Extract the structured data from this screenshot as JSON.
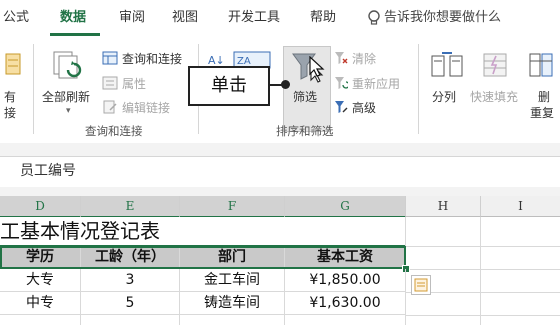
{
  "tabs": [
    {
      "label": "公式",
      "active": false
    },
    {
      "label": "数据",
      "active": true
    },
    {
      "label": "审阅",
      "active": false
    },
    {
      "label": "视图",
      "active": false
    },
    {
      "label": "开发工具",
      "active": false
    },
    {
      "label": "帮助",
      "active": false
    }
  ],
  "tell_me": "告诉我你想要做什么",
  "ribbon": {
    "partial_left_1": "有",
    "partial_left_2": "接",
    "refresh_all": "全部刷新",
    "queries_connections": "查询和连接",
    "properties": "属性",
    "edit_links": "编辑链接",
    "group_queries": "查询和连接",
    "filter": "筛选",
    "clear": "清除",
    "reapply": "重新应用",
    "advanced": "高级",
    "group_sort_filter": "排序和筛选",
    "split_column": "分列",
    "flash_fill": "快速填充",
    "partial_right_1": "删",
    "partial_right_2": "重复"
  },
  "callout": "单击",
  "formula_bar": {
    "value": "员工编号"
  },
  "columns": [
    {
      "label": "D",
      "selected": true
    },
    {
      "label": "E",
      "selected": true
    },
    {
      "label": "F",
      "selected": true
    },
    {
      "label": "G",
      "selected": true
    },
    {
      "label": "H",
      "selected": false
    },
    {
      "label": "I",
      "selected": false
    }
  ],
  "sheet": {
    "title": "工基本情况登记表",
    "headers": [
      "学历",
      "工龄（年）",
      "部门",
      "基本工资"
    ],
    "rows": [
      [
        "大专",
        "3",
        "金工车间",
        "¥1,850.00"
      ],
      [
        "中专",
        "5",
        "铸造车间",
        "¥1,630.00"
      ]
    ]
  },
  "colors": {
    "accent": "#217346",
    "header_fill": "#c9c9c9",
    "selected_button": "#e6e6e6"
  }
}
